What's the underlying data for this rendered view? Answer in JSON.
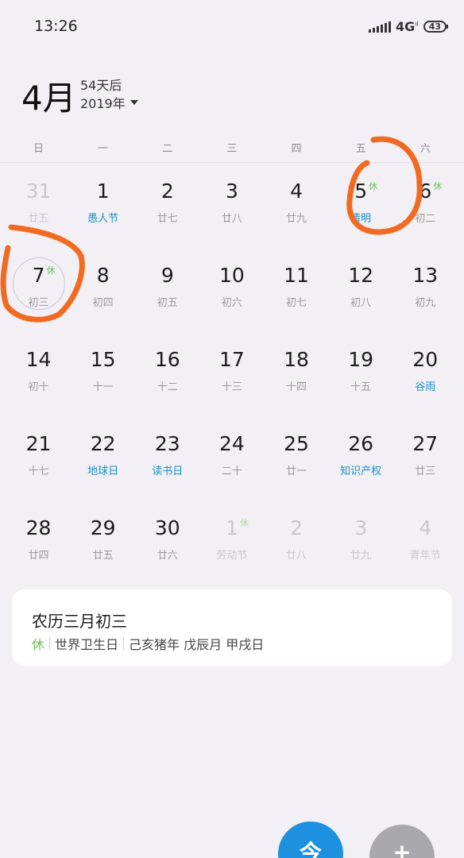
{
  "status": {
    "time": "13:26",
    "network": "4G",
    "network_sup": "ıl",
    "battery": "43"
  },
  "header": {
    "month": "4月",
    "days_after": "54天后",
    "year": "2019年"
  },
  "weekdays": [
    "日",
    "一",
    "二",
    "三",
    "四",
    "五",
    "六"
  ],
  "days": [
    {
      "num": "31",
      "sub": "廿五",
      "dim": true,
      "fest": false,
      "rest": ""
    },
    {
      "num": "1",
      "sub": "愚人节",
      "dim": false,
      "fest": true,
      "rest": ""
    },
    {
      "num": "2",
      "sub": "廿七",
      "dim": false,
      "fest": false,
      "rest": ""
    },
    {
      "num": "3",
      "sub": "廿八",
      "dim": false,
      "fest": false,
      "rest": ""
    },
    {
      "num": "4",
      "sub": "廿九",
      "dim": false,
      "fest": false,
      "rest": ""
    },
    {
      "num": "5",
      "sub": "清明",
      "dim": false,
      "fest": true,
      "rest": "休"
    },
    {
      "num": "6",
      "sub": "初二",
      "dim": false,
      "fest": false,
      "rest": "休"
    },
    {
      "num": "7",
      "sub": "初三",
      "dim": false,
      "fest": false,
      "rest": "休",
      "selected": true
    },
    {
      "num": "8",
      "sub": "初四",
      "dim": false,
      "fest": false,
      "rest": ""
    },
    {
      "num": "9",
      "sub": "初五",
      "dim": false,
      "fest": false,
      "rest": ""
    },
    {
      "num": "10",
      "sub": "初六",
      "dim": false,
      "fest": false,
      "rest": ""
    },
    {
      "num": "11",
      "sub": "初七",
      "dim": false,
      "fest": false,
      "rest": ""
    },
    {
      "num": "12",
      "sub": "初八",
      "dim": false,
      "fest": false,
      "rest": ""
    },
    {
      "num": "13",
      "sub": "初九",
      "dim": false,
      "fest": false,
      "rest": ""
    },
    {
      "num": "14",
      "sub": "初十",
      "dim": false,
      "fest": false,
      "rest": ""
    },
    {
      "num": "15",
      "sub": "十一",
      "dim": false,
      "fest": false,
      "rest": ""
    },
    {
      "num": "16",
      "sub": "十二",
      "dim": false,
      "fest": false,
      "rest": ""
    },
    {
      "num": "17",
      "sub": "十三",
      "dim": false,
      "fest": false,
      "rest": ""
    },
    {
      "num": "18",
      "sub": "十四",
      "dim": false,
      "fest": false,
      "rest": ""
    },
    {
      "num": "19",
      "sub": "十五",
      "dim": false,
      "fest": false,
      "rest": ""
    },
    {
      "num": "20",
      "sub": "谷雨",
      "dim": false,
      "fest": true,
      "rest": ""
    },
    {
      "num": "21",
      "sub": "十七",
      "dim": false,
      "fest": false,
      "rest": ""
    },
    {
      "num": "22",
      "sub": "地球日",
      "dim": false,
      "fest": true,
      "rest": ""
    },
    {
      "num": "23",
      "sub": "读书日",
      "dim": false,
      "fest": true,
      "rest": ""
    },
    {
      "num": "24",
      "sub": "二十",
      "dim": false,
      "fest": false,
      "rest": ""
    },
    {
      "num": "25",
      "sub": "廿一",
      "dim": false,
      "fest": false,
      "rest": ""
    },
    {
      "num": "26",
      "sub": "知识产权",
      "dim": false,
      "fest": true,
      "rest": ""
    },
    {
      "num": "27",
      "sub": "廿三",
      "dim": false,
      "fest": false,
      "rest": ""
    },
    {
      "num": "28",
      "sub": "廿四",
      "dim": false,
      "fest": false,
      "rest": ""
    },
    {
      "num": "29",
      "sub": "廿五",
      "dim": false,
      "fest": false,
      "rest": ""
    },
    {
      "num": "30",
      "sub": "廿六",
      "dim": false,
      "fest": false,
      "rest": ""
    },
    {
      "num": "1",
      "sub": "劳动节",
      "dim": true,
      "fest": false,
      "rest": "休"
    },
    {
      "num": "2",
      "sub": "廿八",
      "dim": true,
      "fest": false,
      "rest": ""
    },
    {
      "num": "3",
      "sub": "廿九",
      "dim": true,
      "fest": false,
      "rest": ""
    },
    {
      "num": "4",
      "sub": "青年节",
      "dim": true,
      "fest": false,
      "rest": ""
    }
  ],
  "info": {
    "lunar_date": "农历三月初三",
    "rest": "休",
    "festival": "世界卫生日",
    "ganzhi": "己亥猪年 戊辰月 甲戌日"
  },
  "fab": {
    "today_label": "今",
    "add_label": "+"
  },
  "colors": {
    "accent": "#1e90e0",
    "festival": "#1a8fc9",
    "rest": "#6cbf57",
    "annotation": "#f26a21"
  }
}
